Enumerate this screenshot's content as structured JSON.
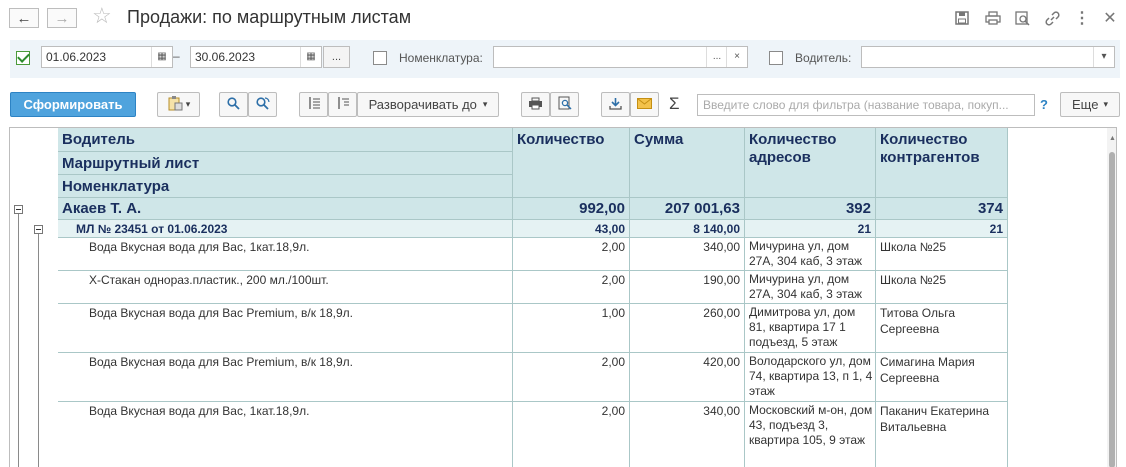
{
  "window": {
    "title": "Продажи: по маршрутным листам",
    "back_icon": "←",
    "forward_icon": "→",
    "favorite_icon": "☆",
    "toolbar_icons": [
      "save-icon",
      "print-icon",
      "preview-icon",
      "link-icon",
      "more-icon",
      "close-icon"
    ]
  },
  "filters": {
    "period_enabled": true,
    "date_from": "01.06.2023",
    "dash": "–",
    "date_to": "30.06.2023",
    "period_select_label": "...",
    "nomenclature_enabled": false,
    "nomenclature_label": "Номенклатура:",
    "nomenclature_value": "",
    "nomenclature_pick": "...",
    "nomenclature_clear": "×",
    "driver_enabled": false,
    "driver_label": "Водитель:",
    "driver_value": ""
  },
  "toolbar": {
    "generate_label": "Сформировать",
    "expand_label": "Разворачивать до",
    "search_placeholder": "Введите слово для фильтра (название товара, покуп...",
    "help_label": "?",
    "more_label": "Еще"
  },
  "report": {
    "headers": {
      "driver": "Водитель",
      "route_sheet": "Маршрутный лист",
      "nomenclature": "Номенклатура",
      "quantity": "Количество",
      "sum": "Сумма",
      "addresses": "Количество адресов",
      "counterparties": "Количество контрагентов"
    },
    "group": {
      "name": "Акаев Т. А.",
      "quantity": "992,00",
      "sum": "207 001,63",
      "addresses": "392",
      "counterparties": "374"
    },
    "subgroup": {
      "name": "МЛ № 23451 от 01.06.2023",
      "quantity": "43,00",
      "sum": "8 140,00",
      "addresses": "21",
      "counterparties": "21"
    },
    "rows": [
      {
        "name": "Вода Вкусная вода для Вас, 1кат.18,9л.",
        "quantity": "2,00",
        "sum": "340,00",
        "address": "Мичурина ул,  дом 27А, 304 каб, 3 этаж",
        "counterparty": "Школа №25"
      },
      {
        "name": "Х-Стакан однораз.пластик., 200 мл./100шт.",
        "quantity": "2,00",
        "sum": "190,00",
        "address": "Мичурина ул,  дом 27А, 304 каб, 3 этаж",
        "counterparty": "Школа №25"
      },
      {
        "name": "Вода Вкусная вода для Вас Premium, в/к 18,9л.",
        "quantity": "1,00",
        "sum": "260,00",
        "address": "Димитрова ул,  дом 81,  квартира 17 1 подъезд, 5 этаж",
        "counterparty": "Титова Ольга Сергеевна"
      },
      {
        "name": "Вода Вкусная вода для Вас Premium, в/к 18,9л.",
        "quantity": "2,00",
        "sum": "420,00",
        "address": "Володарского ул, дом 74,  квартира 13, п 1, 4 этаж",
        "counterparty": "Симагина Мария Сергеевна"
      },
      {
        "name": "Вода Вкусная вода для Вас, 1кат.18,9л.",
        "quantity": "2,00",
        "sum": "340,00",
        "address": "Московский м-он, дом 43,  подъезд 3, квартира 105, 9 этаж",
        "counterparty": "Паканич Екатерина Витальевна"
      }
    ]
  }
}
